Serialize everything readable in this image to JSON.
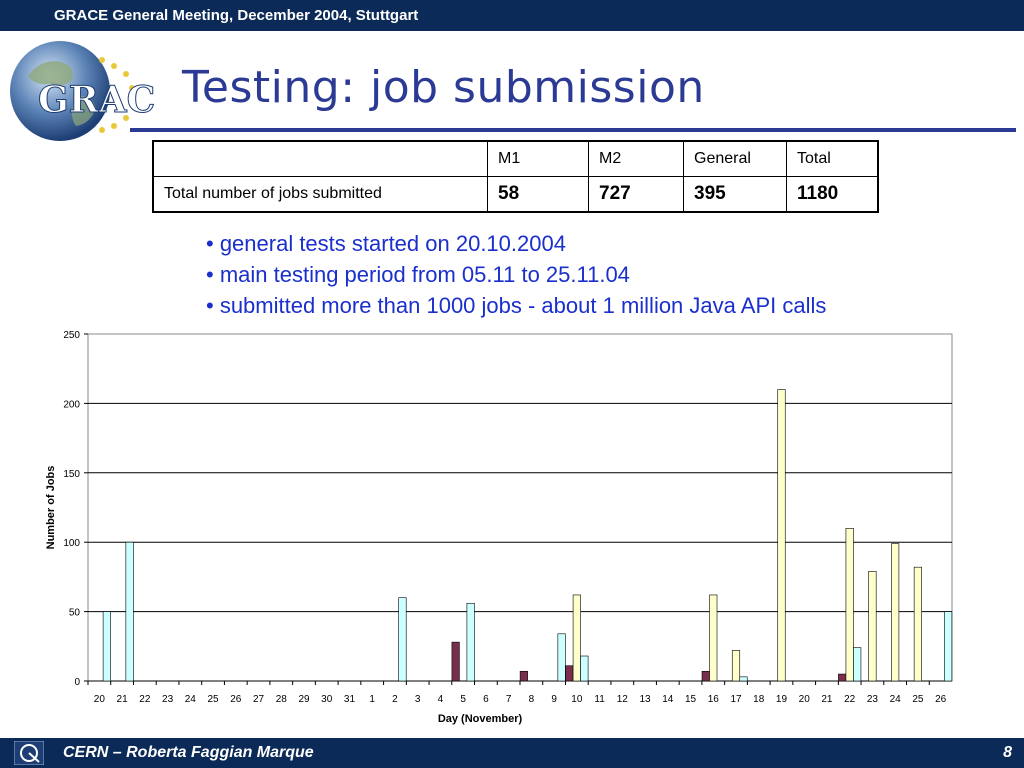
{
  "header": {
    "text": "GRACE General Meeting, December 2004, Stuttgart"
  },
  "logo": {
    "text": "GRACE"
  },
  "slide": {
    "title": "Testing: job submission"
  },
  "table": {
    "headers": [
      "",
      "M1",
      "M2",
      "General",
      "Total"
    ],
    "row": {
      "label": "Total number of jobs submitted",
      "values": [
        "58",
        "727",
        "395",
        "1180"
      ]
    }
  },
  "bullets": [
    "• general tests started on 20.10.2004",
    "• main testing period from 05.11 to 25.11.04",
    "• submitted more than 1000 jobs - about 1 million Java API calls"
  ],
  "chart_data": {
    "type": "bar",
    "xlabel": "Day (November)",
    "ylabel": "Number of Jobs",
    "ylim": [
      0,
      250
    ],
    "yticks": [
      0,
      50,
      100,
      150,
      200,
      250
    ],
    "grid": true,
    "legend": "none",
    "categories": [
      "20",
      "21",
      "22",
      "23",
      "24",
      "25",
      "26",
      "27",
      "28",
      "29",
      "30",
      "31",
      "1",
      "2",
      "3",
      "4",
      "5",
      "6",
      "7",
      "8",
      "9",
      "10",
      "11",
      "12",
      "13",
      "14",
      "15",
      "16",
      "17",
      "18",
      "19",
      "20",
      "21",
      "22",
      "23",
      "24",
      "25",
      "26"
    ],
    "series": [
      {
        "color": "#7a2e4e",
        "values": [
          0,
          0,
          0,
          0,
          0,
          0,
          0,
          0,
          0,
          0,
          0,
          0,
          0,
          0,
          0,
          0,
          28,
          0,
          0,
          7,
          0,
          11,
          0,
          0,
          0,
          0,
          0,
          7,
          0,
          0,
          0,
          0,
          0,
          5,
          0,
          0,
          0,
          0
        ]
      },
      {
        "color": "#ffffcc",
        "values": [
          0,
          0,
          0,
          0,
          0,
          0,
          0,
          0,
          0,
          0,
          0,
          0,
          0,
          0,
          0,
          0,
          0,
          0,
          0,
          0,
          0,
          62,
          0,
          0,
          0,
          0,
          0,
          62,
          22,
          0,
          210,
          0,
          0,
          110,
          79,
          99,
          82,
          0
        ]
      },
      {
        "color": "#ccffff",
        "values": [
          50,
          100,
          0,
          0,
          0,
          0,
          0,
          0,
          0,
          0,
          0,
          0,
          0,
          60,
          0,
          0,
          56,
          0,
          0,
          0,
          34,
          18,
          0,
          0,
          0,
          0,
          0,
          0,
          3,
          0,
          0,
          0,
          0,
          24,
          0,
          0,
          0,
          50
        ]
      }
    ]
  },
  "footer": {
    "text": "CERN – Roberta Faggian Marque",
    "page": "8"
  }
}
